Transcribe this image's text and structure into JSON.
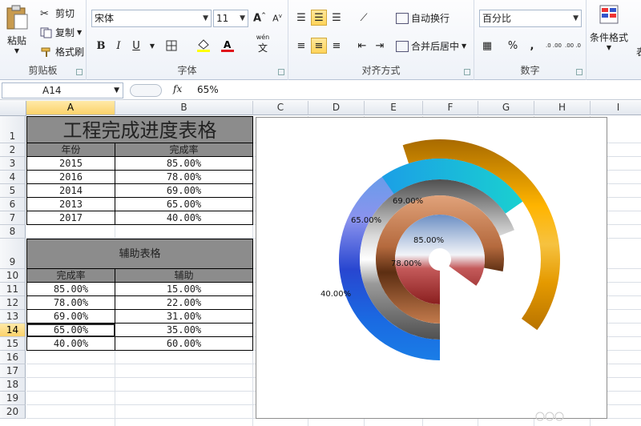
{
  "ribbon": {
    "clipboard": {
      "paste": "粘贴",
      "cut": "剪切",
      "copy": "复制",
      "format_painter": "格式刷",
      "label": "剪贴板"
    },
    "font": {
      "name": "宋体",
      "size": "11",
      "bold": "B",
      "italic": "I",
      "underline": "U",
      "phonetic": "wén",
      "label": "字体",
      "font_color": "#e0141b",
      "fill_color": "#ffff00"
    },
    "alignment": {
      "wrap": "自动换行",
      "merge": "合并后居中",
      "label": "对齐方式"
    },
    "number": {
      "format": "百分比",
      "percent": "%",
      "comma": ",",
      "inc": ".0 .00",
      "dec": ".00 .0",
      "label": "数字"
    },
    "styles": {
      "conditional": "条件格式",
      "table_fmt_partial": "表"
    }
  },
  "formula_bar": {
    "name_box": "A14",
    "fx": "fx",
    "formula": "65%"
  },
  "columns": [
    "A",
    "B",
    "C",
    "D",
    "E",
    "F",
    "G",
    "H",
    "I"
  ],
  "selected_column": "A",
  "rows": [
    "1",
    "2",
    "3",
    "4",
    "5",
    "6",
    "7",
    "8",
    "9",
    "10",
    "11",
    "12",
    "13",
    "14",
    "15",
    "16",
    "17",
    "18",
    "19",
    "20"
  ],
  "selected_row": "14",
  "sheet": {
    "title": "工程完成进度表格",
    "table1_headers": [
      "年份",
      "完成率"
    ],
    "table1_rows": [
      [
        "2015",
        "85.00%"
      ],
      [
        "2016",
        "78.00%"
      ],
      [
        "2014",
        "69.00%"
      ],
      [
        "2013",
        "65.00%"
      ],
      [
        "2017",
        "40.00%"
      ]
    ],
    "aux_title": "辅助表格",
    "table2_headers": [
      "完成率",
      "辅助"
    ],
    "table2_rows": [
      [
        "85.00%",
        "15.00%"
      ],
      [
        "78.00%",
        "22.00%"
      ],
      [
        "69.00%",
        "31.00%"
      ],
      [
        "65.00%",
        "35.00%"
      ],
      [
        "40.00%",
        "60.00%"
      ]
    ]
  },
  "chart_data": {
    "type": "doughnut",
    "series": [
      {
        "label": "40.00%",
        "value": 40,
        "aux": 60,
        "color": "#f2a300"
      },
      {
        "label": "65.00%",
        "value": 65,
        "aux": 35,
        "color": "#2a6fe0"
      },
      {
        "label": "69.00%",
        "value": 69,
        "aux": 31,
        "color": "#8c8c8c"
      },
      {
        "label": "78.00%",
        "value": 78,
        "aux": 22,
        "color": "#c8703c"
      },
      {
        "label": "85.00%",
        "value": 85,
        "aux": 15,
        "color": "#8fa9c8"
      }
    ],
    "cyan_ring_color": "#18c6d4"
  }
}
